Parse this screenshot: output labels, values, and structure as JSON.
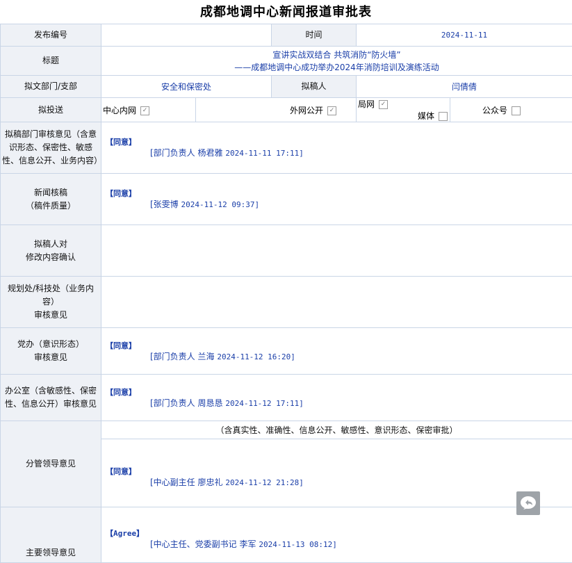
{
  "title": "成都地调中心新闻报道审批表",
  "row_number": {
    "label": "发布编号",
    "value": ""
  },
  "row_time": {
    "label": "时间",
    "value": "2024-11-11"
  },
  "row_subject": {
    "label": "标题",
    "line1": "宣讲实战双结合 共筑消防“防火墙”",
    "line2": "——成都地调中心成功举办2024年消防培训及演练活动"
  },
  "row_dept": {
    "label": "拟文部门/支部",
    "value": "安全和保密处"
  },
  "row_drafter": {
    "label": "拟稿人",
    "value": "闫倩倩"
  },
  "row_send": {
    "label": "拟投送",
    "options": [
      {
        "label": "中心内网",
        "checked": true
      },
      {
        "label": "外网公开",
        "checked": true
      },
      {
        "label": "局网",
        "checked": true
      },
      {
        "label": "媒体",
        "checked": false
      },
      {
        "label": "公众号",
        "checked": false
      }
    ]
  },
  "reviews": {
    "draft_dept": {
      "label": "拟稿部门审核意见（含意识形态、保密性、敏感性、信息公开、业务内容）",
      "opinion": "【同意】",
      "signer": "[部门负责人 杨君雅",
      "time": "2024-11-11 17:11]"
    },
    "news_check": {
      "label1": "新闻核稿",
      "label2": "（稿件质量）",
      "opinion": "【同意】",
      "signer": "[张雯博",
      "time": "2024-11-12 09:37]"
    },
    "drafter_confirm": {
      "label1": "拟稿人对",
      "label2": "修改内容确认"
    },
    "planning": {
      "label1": "规划处/科技处（业务内容）",
      "label2": "审核意见"
    },
    "party_office": {
      "label1": "党办（意识形态）",
      "label2": "审核意见",
      "opinion": "【同意】",
      "signer": "[部门负责人 兰海",
      "time": "2024-11-12 16:20]"
    },
    "office": {
      "label": "办公室（含敏感性、保密性、信息公开）审核意见",
      "opinion": "【同意】",
      "signer": "[部门负责人 周恳恳",
      "time": "2024-11-12 17:11]"
    },
    "leader_in_charge": {
      "label": "分管领导意见",
      "note": "（含真实性、准确性、信息公开、敏感性、意识形态、保密审批）",
      "opinion": "【同意】",
      "signer": "[中心副主任 廖忠礼",
      "time": "2024-11-12 21:28]"
    },
    "main_leader": {
      "label": "主要领导意见",
      "opinion": "【Agree】",
      "signer": "[中心主任、党委副书记 李军",
      "time": "2024-11-13 08:12]"
    }
  },
  "icons": {
    "float_button": "reply-arrow-icon"
  },
  "colors": {
    "label_bg": "#eef1f6",
    "border": "#c9d5e6",
    "value_text": "#1a3ea8",
    "float_button_bg": "#9ea3a8"
  }
}
